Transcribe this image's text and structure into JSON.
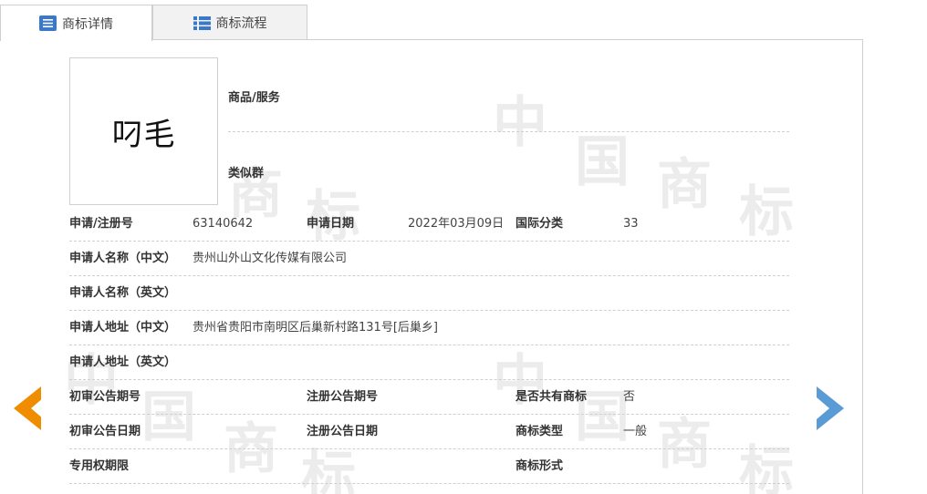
{
  "tabs": [
    {
      "label": "商标详情",
      "icon": "list-doc-icon",
      "active": true
    },
    {
      "label": "商标流程",
      "icon": "grid-list-icon",
      "active": false
    }
  ],
  "colors": {
    "accent_orange": "#f08c00",
    "accent_blue": "#5b9bd5",
    "tab_icon": "#3a78c9"
  },
  "trademark": {
    "logo_text": "叼毛",
    "goods_services_label": "商品/服务",
    "similar_group_label": "类似群"
  },
  "rows": {
    "r1": {
      "l1": "申请/注册号",
      "v1": "63140642",
      "l2": "申请日期",
      "v2": "2022年03月09日",
      "l3": "国际分类",
      "v3": "33"
    },
    "r2": {
      "l1": "申请人名称（中文）",
      "v1": "贵州山外山文化传媒有限公司"
    },
    "r3": {
      "l1": "申请人名称（英文）",
      "v1": ""
    },
    "r4": {
      "l1": "申请人地址（中文）",
      "v1": "贵州省贵阳市南明区后巢新村路131号[后巢乡]"
    },
    "r5": {
      "l1": "申请人地址（英文）",
      "v1": ""
    },
    "r6": {
      "l1": "初审公告期号",
      "v1": "",
      "l2": "注册公告期号",
      "v2": "",
      "l3": "是否共有商标",
      "v3": "否"
    },
    "r7": {
      "l1": "初审公告日期",
      "v1": "",
      "l2": "注册公告日期",
      "v2": "",
      "l3": "商标类型",
      "v3": "一般"
    },
    "r8": {
      "l1": "专用权期限",
      "v1": "",
      "l3": "商标形式",
      "v3": ""
    }
  },
  "watermark": {
    "chars": [
      "中",
      "国",
      "商",
      "标"
    ]
  },
  "nav": {
    "prev_icon": "arrow-left-icon",
    "next_icon": "arrow-right-icon"
  }
}
